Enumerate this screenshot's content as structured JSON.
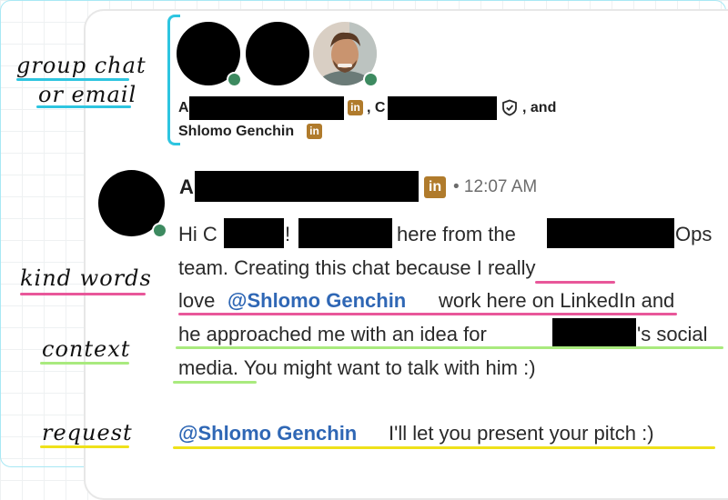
{
  "annotations": {
    "group_chat_line1": "group chat",
    "group_chat_line2": "or email",
    "kind_words": "kind words",
    "context": "context",
    "request": "request"
  },
  "header": {
    "first_initial": "A",
    "second_initial": "C",
    "comma_c": ",",
    "and_text": ", and",
    "third_name": "Shlomo Genchin"
  },
  "message": {
    "sender_initial": "A",
    "timestamp": "• 12:07 AM",
    "linkedin_badge": "in",
    "line1_hi": "Hi C",
    "line1_excl": "!",
    "line1_here": "here from the",
    "line1_ops": "Ops",
    "line2": "team. Creating this chat because I really",
    "line3_love": "love",
    "line3_mention": "@Shlomo Genchin",
    "line3_rest": "work here on LinkedIn and",
    "line4_pre": "he approached me with an idea for",
    "line4_post": "'s social",
    "line5": "media. You might want to talk with him :)",
    "line6_mention": "@Shlomo Genchin",
    "line6_rest": "I'll let you present your pitch :)"
  },
  "colors": {
    "bracket": "#2ec5e0",
    "group_chat_underline": "#2ec5e0",
    "kind_words_underline": "#e8579a",
    "context_underline": "#a9ea7e",
    "request_underline": "#efe11a",
    "mention": "#2f67b5",
    "linkedin_badge": "#b07b2c",
    "presence_dot": "#3d8a60"
  },
  "icons": [
    "linkedin-icon",
    "shield-icon",
    "presence-dot"
  ]
}
